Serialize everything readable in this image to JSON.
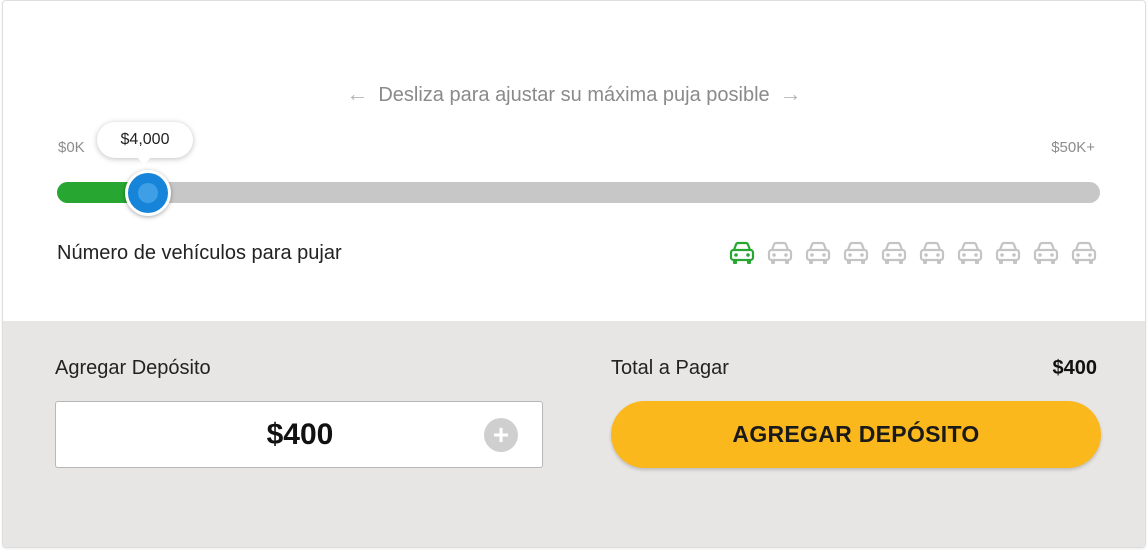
{
  "slider": {
    "hint": "Desliza para ajustar su máxima puja posible",
    "min_label": "$0K",
    "max_label": "$50K+",
    "value_label": "$4,000",
    "value": 4000,
    "max": 50000,
    "fill_color": "#27a732",
    "thumb_color": "#1685d9"
  },
  "vehicles": {
    "label": "Número de vehículos para pujar",
    "total": 10,
    "active": 1,
    "active_color": "#27a732",
    "inactive_color": "#c4c4c4",
    "icon": "car-icon"
  },
  "deposit": {
    "label": "Agregar Depósito",
    "value": "$400",
    "increment_icon": "plus-icon"
  },
  "total": {
    "label": "Total a Pagar",
    "value": "$400"
  },
  "cta": {
    "label": "AGREGAR DEPÓSITO",
    "color": "#fbb81d"
  }
}
